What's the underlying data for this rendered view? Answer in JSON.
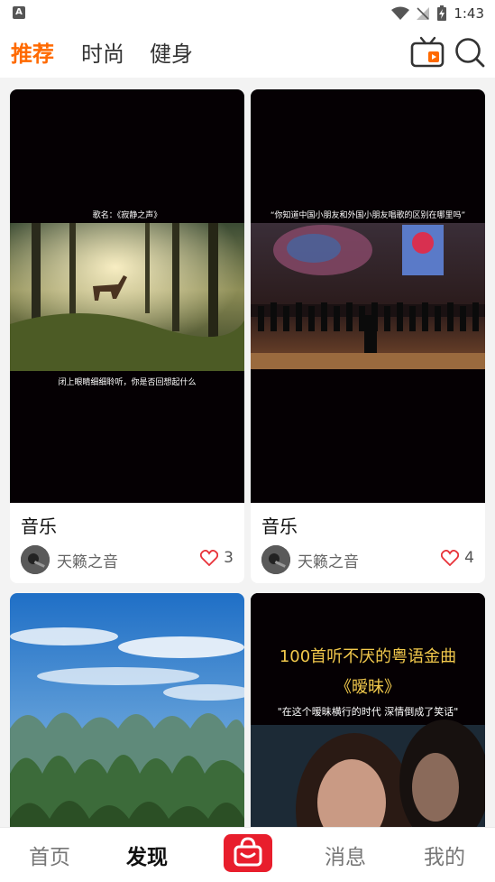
{
  "status_bar": {
    "time": "1:43",
    "left_badge": "A"
  },
  "tabs": [
    "推荐",
    "时尚",
    "健身"
  ],
  "feed": [
    {
      "title": "音乐",
      "author": "天籁之音",
      "likes": "3",
      "overlay_top": "歌名：《寂静之声》",
      "overlay_bottom": "闭上眼睛细细聆听，你是否回想起什么"
    },
    {
      "title": "音乐",
      "author": "天籁之音",
      "likes": "4",
      "overlay_top": "“你知道中国小朋友和外国小朋友唱歌的区别在哪里吗”",
      "overlay_bottom": ""
    },
    {
      "title": "",
      "author": "",
      "likes": "",
      "overlay_top": "",
      "overlay_bottom": ""
    },
    {
      "title": "",
      "author": "",
      "likes": "",
      "overlay_top": "100首听不厌的粤语金曲",
      "overlay_mid": "《暧昧》",
      "overlay_bottom": "\"在这个暧昧横行的时代 深情倒成了笑话\""
    }
  ],
  "bottom_nav": [
    "首页",
    "发现",
    "消息",
    "我的"
  ],
  "colors": {
    "accent": "#ff6a00",
    "brand_red": "#e81e2c",
    "heart": "#e8333a"
  }
}
